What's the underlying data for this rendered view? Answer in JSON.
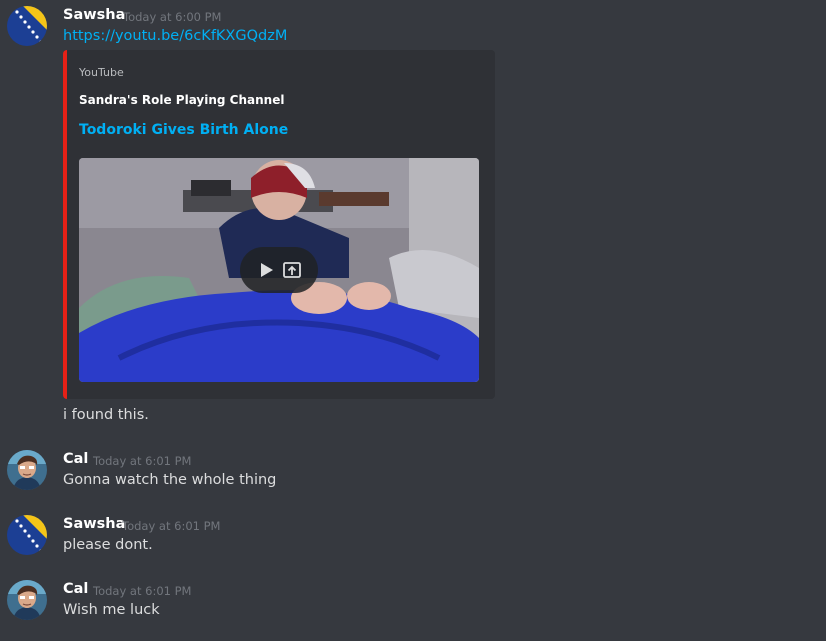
{
  "messages": [
    {
      "username": "Sawsha",
      "timestamp": "Today at 6:00 PM",
      "link": "https://youtu.be/6cKfKXGQdzM",
      "embed": {
        "provider": "YouTube",
        "author": "Sandra's Role Playing Channel",
        "title": "Todoroki Gives Birth Alone",
        "accent_color": "#e62117"
      },
      "text": "i found this."
    },
    {
      "username": "Cal",
      "timestamp": "Today at 6:01 PM",
      "text": "Gonna watch the whole thing"
    },
    {
      "username": "Sawsha",
      "timestamp": "Today at 6:01 PM",
      "text": "please dont."
    },
    {
      "username": "Cal",
      "timestamp": "Today at 6:01 PM",
      "text": "Wish me luck"
    }
  ],
  "colors": {
    "background": "#36393f",
    "embed_background": "#2f3136",
    "link": "#00b0f4",
    "username": "#ffffff",
    "timestamp": "#72767d",
    "text": "#dcddde"
  },
  "icons": {
    "play": "play-icon",
    "open_external": "open-external-icon"
  }
}
